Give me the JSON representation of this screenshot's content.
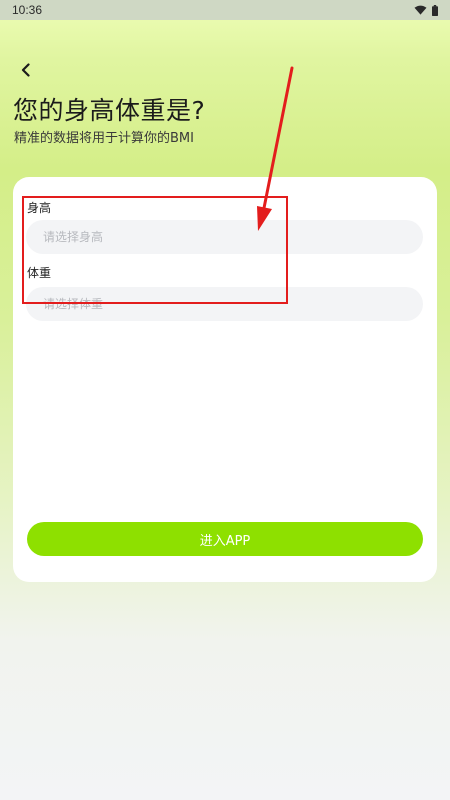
{
  "status_bar": {
    "time": "10:36",
    "icons": [
      "wifi-icon",
      "battery-icon"
    ]
  },
  "header": {
    "back_icon": "chevron-left-icon",
    "title": "您的身高体重是?",
    "subtitle": "精准的数据将用于计算你的BMI"
  },
  "form": {
    "height": {
      "label": "身高",
      "placeholder": "请选择身高",
      "value": ""
    },
    "weight": {
      "label": "体重",
      "placeholder": "请选择体重",
      "value": ""
    },
    "submit_label": "进入APP"
  },
  "colors": {
    "accent": "#8ee000",
    "annotation": "#e31d1d",
    "input_bg": "#f3f4f6",
    "card_bg": "#ffffff"
  }
}
